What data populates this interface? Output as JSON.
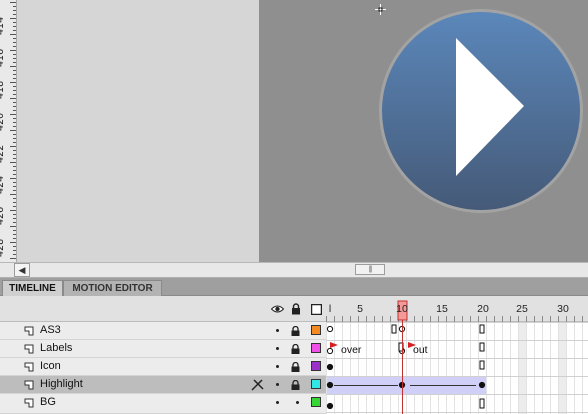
{
  "ruler": {
    "labels": [
      "414",
      "416",
      "418",
      "420",
      "422",
      "424",
      "426",
      "428",
      "430"
    ]
  },
  "stage": {
    "background": "#8f8f8f",
    "button_color_top": "#5b87ba",
    "button_color_bottom": "#455a78"
  },
  "tabs": {
    "timeline": "TIMELINE",
    "motion_editor": "MOTION EDITOR"
  },
  "header": {
    "eye_icon": "eye-icon",
    "lock_icon": "lock-icon",
    "outline_icon": "outline-icon",
    "frame_numbers": [
      "l",
      "5",
      "10",
      "15",
      "20",
      "25",
      "30"
    ]
  },
  "playhead_frame": "10",
  "layers": [
    {
      "name": "AS3",
      "color": "#f58a22",
      "selected": false
    },
    {
      "name": "Labels",
      "color": "#f050e8",
      "selected": false
    },
    {
      "name": "Icon",
      "color": "#9a30c8",
      "selected": false
    },
    {
      "name": "Highlight",
      "color": "#30e8e8",
      "selected": true
    },
    {
      "name": "BG",
      "color": "#36d636",
      "selected": false
    }
  ],
  "frame_labels": {
    "over": "over",
    "out": "out"
  }
}
